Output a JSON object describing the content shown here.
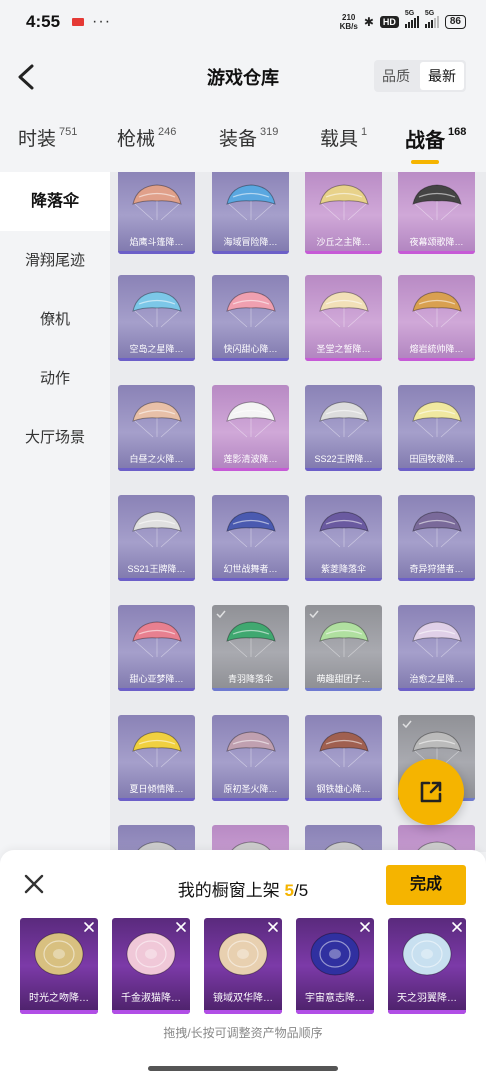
{
  "status_bar": {
    "time": "4:55",
    "dots": "···",
    "net_rate_value": "210",
    "net_rate_unit": "KB/s",
    "bluetooth": "✱",
    "hd": "HD",
    "sig1": "5G",
    "sig2": "5G",
    "battery": "86"
  },
  "header": {
    "title": "游戏仓库",
    "sort_quality": "品质",
    "sort_latest": "最新"
  },
  "tabs": [
    {
      "label": "时装",
      "count": "751"
    },
    {
      "label": "枪械",
      "count": "246"
    },
    {
      "label": "装备",
      "count": "319"
    },
    {
      "label": "载具",
      "count": "1"
    },
    {
      "label": "战备",
      "count": "168"
    }
  ],
  "sidebar": {
    "items": [
      {
        "label": "降落伞"
      },
      {
        "label": "滑翔尾迹"
      },
      {
        "label": "僚机"
      },
      {
        "label": "动作"
      },
      {
        "label": "大厅场景"
      }
    ]
  },
  "grid": {
    "items": [
      {
        "name": "焰鹰斗篷降…",
        "tier": "purple",
        "color": "#e0a08a"
      },
      {
        "name": "海域冒险降…",
        "tier": "purple",
        "color": "#5aa7e0"
      },
      {
        "name": "沙丘之主降…",
        "tier": "pink",
        "color": "#e8d28a"
      },
      {
        "name": "夜幕颂歌降…",
        "tier": "pink",
        "color": "#444444"
      },
      {
        "name": "空岛之星降…",
        "tier": "purple",
        "color": "#7cc7e8"
      },
      {
        "name": "快闪甜心降…",
        "tier": "purple",
        "color": "#f0a0b0"
      },
      {
        "name": "圣堂之誓降…",
        "tier": "pink",
        "color": "#f2e0b8"
      },
      {
        "name": "熔岩統帅降…",
        "tier": "pink",
        "color": "#d9a050"
      },
      {
        "name": "白昼之火降…",
        "tier": "purple",
        "color": "#e8c0a8"
      },
      {
        "name": "莲影清波降…",
        "tier": "pink",
        "color": "#f4f4f4"
      },
      {
        "name": "SS22王牌降…",
        "tier": "purple",
        "color": "#dddddd"
      },
      {
        "name": "田园牧歌降…",
        "tier": "purple",
        "color": "#f0e8a0"
      },
      {
        "name": "SS21王牌降…",
        "tier": "purple",
        "color": "#e0e0e0"
      },
      {
        "name": "幻世战舞者…",
        "tier": "purple",
        "color": "#4a5ab0"
      },
      {
        "name": "紫菱降落伞",
        "tier": "purple",
        "color": "#6a5aa0"
      },
      {
        "name": "奇异狩猎者…",
        "tier": "purple",
        "color": "#7a6a9a"
      },
      {
        "name": "甜心亚梦降…",
        "tier": "purple",
        "color": "#e88090"
      },
      {
        "name": "青羽降落伞",
        "tier": "grey",
        "color": "#40a870"
      },
      {
        "name": "萌趣甜团子…",
        "tier": "grey",
        "color": "#b0e0a0"
      },
      {
        "name": "治愈之星降…",
        "tier": "purple",
        "color": "#e0d0e8"
      },
      {
        "name": "夏日倾情降…",
        "tier": "purple",
        "color": "#f0d040"
      },
      {
        "name": "原初圣火降…",
        "tier": "purple",
        "color": "#c0a0b0"
      },
      {
        "name": "钢铁雄心降…",
        "tier": "purple",
        "color": "#a06050"
      },
      {
        "name": "",
        "tier": "grey",
        "color": "#bbbbbb"
      },
      {
        "name": "",
        "tier": "purple",
        "color": "#cccccc"
      },
      {
        "name": "",
        "tier": "pink",
        "color": "#cccccc"
      },
      {
        "name": "",
        "tier": "purple",
        "color": "#cccccc"
      },
      {
        "name": "",
        "tier": "pink",
        "color": "#cccccc"
      }
    ]
  },
  "fab": {
    "icon": "share-icon"
  },
  "showcase": {
    "title_prefix": "我的橱窗上架 ",
    "current": "5",
    "separator": "/",
    "total": "5",
    "done_label": "完成",
    "hint": "拖拽/长按可调整资产物品顺序",
    "slots": [
      {
        "name": "时光之吻降…",
        "color": "#d8c080"
      },
      {
        "name": "千金淑猫降…",
        "color": "#f0c8d8"
      },
      {
        "name": "镜域双华降…",
        "color": "#e8d0b0"
      },
      {
        "name": "宇宙意志降…",
        "color": "#3030a0"
      },
      {
        "name": "天之羽翼降…",
        "color": "#c8e0f0"
      }
    ]
  },
  "colors": {
    "accent": "#f5b400",
    "purple_tier": "#6c5fc8",
    "pink_tier": "#c65ad6"
  }
}
